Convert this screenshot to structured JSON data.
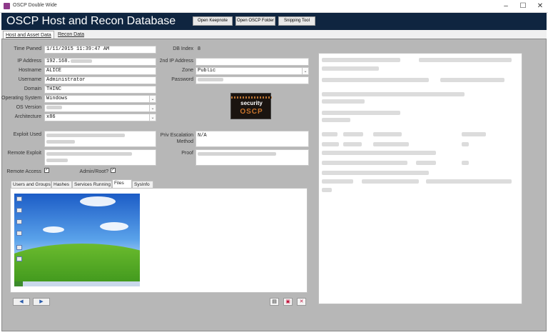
{
  "window": {
    "title": "OSCP Double Wide",
    "minimize": "–",
    "maximize": "☐",
    "close": "✕"
  },
  "header": {
    "app_title": "OSCP Host and Recon Database",
    "buttons": [
      "Open Keepnote",
      "Open OSCP Folder",
      "Snipping Tool"
    ]
  },
  "tabs": [
    "Host and Asset Data",
    "Recon Data"
  ],
  "form": {
    "time_pwned_label": "Time Pwned",
    "time_pwned": "1/11/2015 11:39:47 AM",
    "db_index_label": "DB Index",
    "db_index": "8",
    "ip_label": "IP Address",
    "ip": "192.168.",
    "ip2_label": "2nd IP Address",
    "ip2": "",
    "hostname_label": "Hostname",
    "hostname": "ALICE",
    "zone_label": "Zone",
    "zone": "Public",
    "username_label": "Username",
    "username": "Administrator",
    "password_label": "Password",
    "domain_label": "Domain",
    "domain": "THINC",
    "os_label": "Operating System",
    "os": "Windows",
    "os_version_label": "OS Version",
    "arch_label": "Architecture",
    "arch": "x86",
    "exploit_used_label": "Exploit Used",
    "priv_esc_label": "Priv Escalation Method",
    "priv_esc": "N/A",
    "remote_exploit_label": "Remote Exploit",
    "proof_label": "Proof",
    "remote_access_label": "Remote Access",
    "admin_root_label": "Admin/Root?"
  },
  "logo": {
    "line1": "security",
    "line2": "OSCP"
  },
  "subtabs": [
    "Users and Groups",
    "Hashes",
    "Services Running",
    "Files",
    "SysInfo"
  ],
  "nav": {
    "prev": "◀",
    "next": "▶"
  },
  "colors": {
    "header_bg": "#0f2540",
    "main_bg": "#b7b7b7"
  }
}
